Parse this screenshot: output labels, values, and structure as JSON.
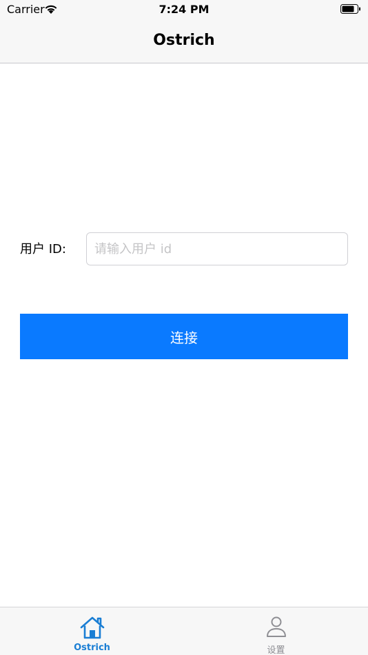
{
  "status_bar": {
    "carrier": "Carrier",
    "time": "7:24 PM",
    "icons": [
      "wifi-icon",
      "battery-icon"
    ]
  },
  "nav": {
    "title": "Ostrich"
  },
  "form": {
    "user_id_label": "用户 ID:",
    "user_id_placeholder": "请输入用户 id",
    "user_id_value": "",
    "connect_label": "连接"
  },
  "tab_bar": {
    "tabs": [
      {
        "label": "Ostrich",
        "icon": "home-icon",
        "selected": true
      },
      {
        "label": "设置",
        "icon": "person-icon",
        "selected": false
      }
    ]
  },
  "colors": {
    "accent": "#0a7aff",
    "tab_selected": "#1a7ed4",
    "tab_unselected": "#8e8e93",
    "placeholder": "#c4c4c6",
    "bar_background": "#f7f7f7"
  }
}
